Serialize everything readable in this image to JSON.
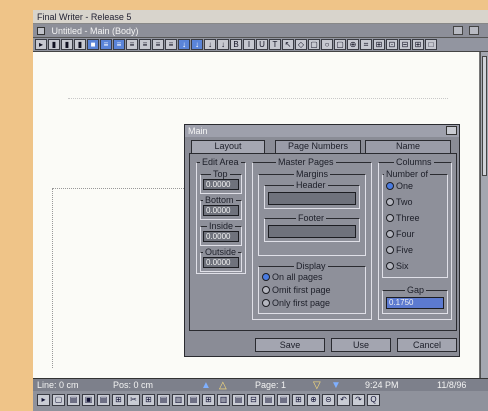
{
  "app": {
    "title": "Final Writer - Release 5",
    "document_title": "Untitled - Main (Body)"
  },
  "toolbar": {
    "buttons": [
      "▸",
      "▮",
      "▮",
      "▮",
      "■",
      "≡",
      "≡",
      "≡",
      "≡",
      "≡",
      "≡",
      "↓",
      "↓",
      "↓",
      "↓",
      "B",
      "I",
      "U",
      "T",
      "↖",
      "◇",
      "▢",
      "○",
      "▢",
      "⊕",
      "⌗",
      "⊞",
      "⊡",
      "⊟",
      "⊞",
      "□"
    ]
  },
  "dialog": {
    "title": "Main",
    "tabs": [
      "Layout",
      "Page Numbers",
      "Name"
    ],
    "edit_area": {
      "label": "Edit Area",
      "top_label": "Top",
      "top_value": "0.0000",
      "bottom_label": "Bottom",
      "bottom_value": "0.0000",
      "inside_label": "Inside",
      "inside_value": "0.0000",
      "outside_label": "Outside",
      "outside_value": "0.0000"
    },
    "master_pages": {
      "label": "Master Pages",
      "margins_label": "Margins",
      "header_label": "Header",
      "header_value": "",
      "footer_label": "Footer",
      "footer_value": ""
    },
    "display": {
      "label": "Display",
      "options": [
        "On all pages",
        "Omit first page",
        "Only first page"
      ],
      "selected": 0
    },
    "columns": {
      "label": "Columns",
      "number_of_label": "Number of",
      "options": [
        "One",
        "Two",
        "Three",
        "Four",
        "Five",
        "Six"
      ],
      "selected": 0,
      "gap_label": "Gap",
      "gap_value": "0.1750"
    },
    "buttons": {
      "save": "Save",
      "use": "Use",
      "cancel": "Cancel"
    }
  },
  "status": {
    "line": "Line: 0 cm",
    "pos": "Pos: 0 cm",
    "page": "Page: 1",
    "time": "9:24 PM",
    "date": "11/8/96"
  },
  "bottom_toolbar": {
    "buttons": [
      "▸",
      "▢",
      "▤",
      "▣",
      "▤",
      "⊞",
      "✂",
      "⊞",
      "▤",
      "▥",
      "▤",
      "⊞",
      "▥",
      "▤",
      "⊟",
      "▤",
      "▤",
      "⊞",
      "⊕",
      "⊝",
      "↶",
      "↷",
      "Q"
    ]
  },
  "colors": {
    "background": "#efc488",
    "dialog": "#8a8c96",
    "accent": "#4a7be0"
  }
}
